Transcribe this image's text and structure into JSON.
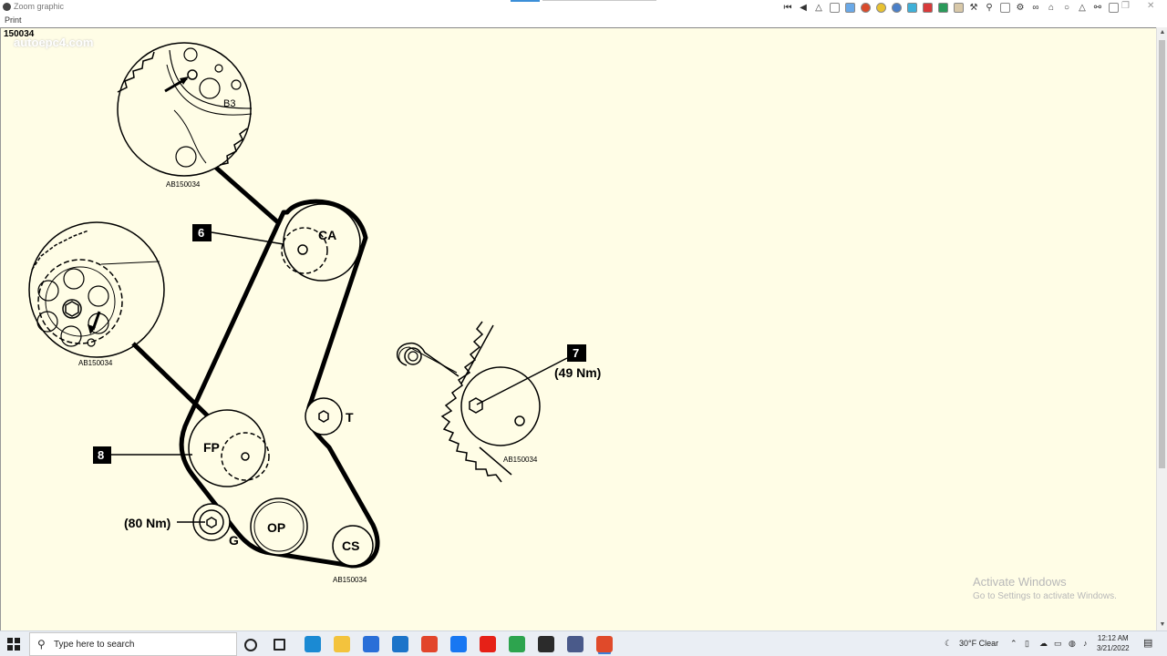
{
  "window": {
    "title": "Zoom graphic",
    "menu_print": "Print",
    "watermark": "autoepc4.com"
  },
  "document": {
    "id": "150034"
  },
  "diagram": {
    "labels": {
      "ca": "CA",
      "fp": "FP",
      "op": "OP",
      "cs": "CS",
      "t": "T",
      "g": "G",
      "b3": "B3",
      "callout_6": "6",
      "callout_7": "7",
      "callout_8": "8",
      "torque_7": "(49 Nm)",
      "torque_g": "(80 Nm)",
      "ref_top": "AB150034",
      "ref_left": "AB150034",
      "ref_right": "AB150034",
      "ref_bottom": "AB150034"
    }
  },
  "activation": {
    "line1": "Activate Windows",
    "line2": "Go to Settings to activate Windows."
  },
  "taskbar": {
    "search_placeholder": "Type here to search",
    "weather": "30°F  Clear",
    "time": "12:12 AM",
    "date": "3/21/2022",
    "apps": [
      {
        "name": "edge",
        "color": "#1b8ad3"
      },
      {
        "name": "file-explorer",
        "color": "#f3c33d"
      },
      {
        "name": "store",
        "color": "#2a6fd8"
      },
      {
        "name": "mail",
        "color": "#1c74c9"
      },
      {
        "name": "office",
        "color": "#e2452b"
      },
      {
        "name": "facebook",
        "color": "#1877f2"
      },
      {
        "name": "youtube",
        "color": "#e62117"
      },
      {
        "name": "chrome",
        "color": "#2da44e"
      },
      {
        "name": "terminal",
        "color": "#2b2b2b"
      },
      {
        "name": "app-globe",
        "color": "#4a5a8a"
      },
      {
        "name": "epc-app",
        "color": "#e04a2a"
      }
    ]
  }
}
